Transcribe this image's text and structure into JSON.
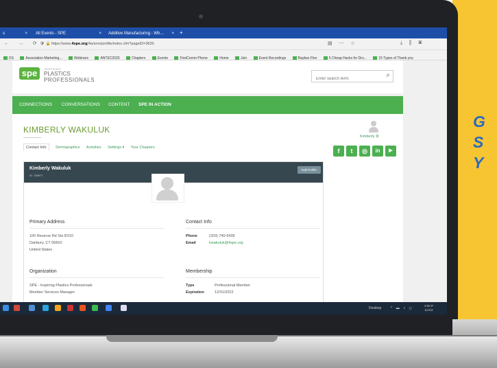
{
  "side_text": [
    "G",
    "S",
    "Y"
  ],
  "browser": {
    "tabs": [
      {
        "label": "s",
        "close": "×"
      },
      {
        "label": "All Events - SPE",
        "close": "×"
      },
      {
        "label": "Additive Manufacturing - Wh...",
        "close": "×"
      }
    ],
    "new_tab": "+",
    "url_prefix": "https://www.",
    "url_domain": "4spe.org",
    "url_rest": "/4a/sms/profile/index.cfm?pageID=3639",
    "bookmarks": [
      "DS",
      "Association Marketing...",
      "Webinars",
      "ANTEC2020",
      "Chapters",
      "Events",
      "FirstComm Phone",
      "Home",
      "Join",
      "Event Recordings",
      "Raybex Flex",
      "5 Cheap Hacks for Dro...",
      "15 Types of Thank you"
    ]
  },
  "site": {
    "logo_mark": "spe",
    "logo_tagline": "INSPIRING",
    "logo_line1": "PLASTICS",
    "logo_line2": "PROFESSIONALS",
    "search_placeholder": "Enter search term",
    "nav": [
      "CONNECTIONS",
      "CONVERSATIONS",
      "CONTENT",
      "SPE IN ACTION"
    ]
  },
  "profile": {
    "heading": "KIMBERLY WAKULUK",
    "user_menu": "Kimberly ⚙",
    "tabs": [
      "Contact Info",
      "Demographics",
      "Activities",
      "Settings ▾",
      "Your Chapters"
    ],
    "socials": [
      "f",
      "t",
      "◎",
      "in",
      "▶"
    ],
    "card_name": "Kimberly Wakuluk",
    "card_id": "ID: 765977",
    "edit_button": "Edit Profile",
    "primary_address_title": "Primary Address",
    "address_lines": [
      "100 Reserve Rd Ste B310",
      "Danbury, CT 06810",
      "United States"
    ],
    "contact_title": "Contact Info",
    "phone_label": "Phone",
    "phone": "(203) 740-5439",
    "email_label": "Email",
    "email": "kwakuluk@4spe.org",
    "organization_title": "Organization",
    "organization_lines": [
      "SPE - Inspiring Plastics Professionals",
      "Member Services Manager"
    ],
    "membership_title": "Membership",
    "type_label": "Type",
    "type_value": "Professional Member",
    "expiration_label": "Expiration",
    "expiration_value": "12/31/2022"
  },
  "taskbar": {
    "desktop": "Desktop",
    "time": "3:00 P",
    "date": "11/1/2"
  }
}
